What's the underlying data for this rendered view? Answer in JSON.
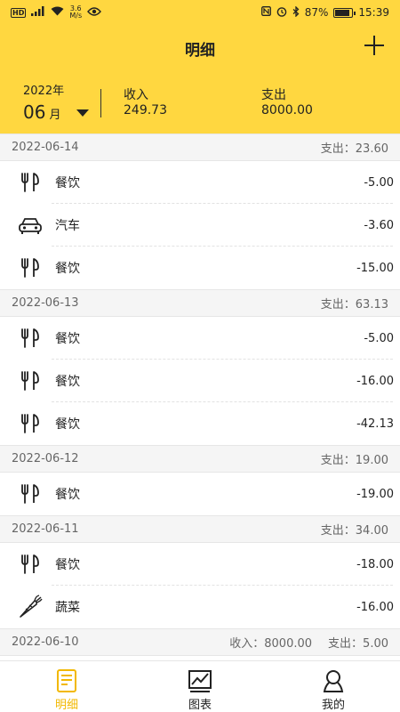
{
  "status_bar": {
    "network": "HD",
    "signal": "4G",
    "speed_value": "3.6",
    "speed_unit": "M/s",
    "battery": "87%",
    "time": "15:39"
  },
  "header": {
    "title": "明细",
    "year": "2022年",
    "month": "06",
    "month_unit": "月",
    "income_label": "收入",
    "income_value": "249.73",
    "expense_label": "支出",
    "expense_value": "8000.00"
  },
  "groups": [
    {
      "date": "2022-06-14",
      "summary": [
        {
          "label": "支出：",
          "value": "23.60"
        }
      ],
      "items": [
        {
          "icon": "utensils-icon",
          "category": "餐饮",
          "amount": "-5.00"
        },
        {
          "icon": "car-icon",
          "category": "汽车",
          "amount": "-3.60"
        },
        {
          "icon": "utensils-icon",
          "category": "餐饮",
          "amount": "-15.00"
        }
      ]
    },
    {
      "date": "2022-06-13",
      "summary": [
        {
          "label": "支出：",
          "value": "63.13"
        }
      ],
      "items": [
        {
          "icon": "utensils-icon",
          "category": "餐饮",
          "amount": "-5.00"
        },
        {
          "icon": "utensils-icon",
          "category": "餐饮",
          "amount": "-16.00"
        },
        {
          "icon": "utensils-icon",
          "category": "餐饮",
          "amount": "-42.13"
        }
      ]
    },
    {
      "date": "2022-06-12",
      "summary": [
        {
          "label": "支出：",
          "value": "19.00"
        }
      ],
      "items": [
        {
          "icon": "utensils-icon",
          "category": "餐饮",
          "amount": "-19.00"
        }
      ]
    },
    {
      "date": "2022-06-11",
      "summary": [
        {
          "label": "支出：",
          "value": "34.00"
        }
      ],
      "items": [
        {
          "icon": "utensils-icon",
          "category": "餐饮",
          "amount": "-18.00"
        },
        {
          "icon": "carrot-icon",
          "category": "蔬菜",
          "amount": "-16.00"
        }
      ]
    },
    {
      "date": "2022-06-10",
      "summary": [
        {
          "label": "收入：",
          "value": "8000.00"
        },
        {
          "label": "支出：",
          "value": "5.00"
        }
      ],
      "items": []
    }
  ],
  "tabs": [
    {
      "label": "明细",
      "icon": "notes-icon",
      "active": true
    },
    {
      "label": "图表",
      "icon": "chart-icon",
      "active": false
    },
    {
      "label": "我的",
      "icon": "user-icon",
      "active": false
    }
  ],
  "colors": {
    "accent": "#ffd740",
    "active_tab": "#f2b800"
  }
}
